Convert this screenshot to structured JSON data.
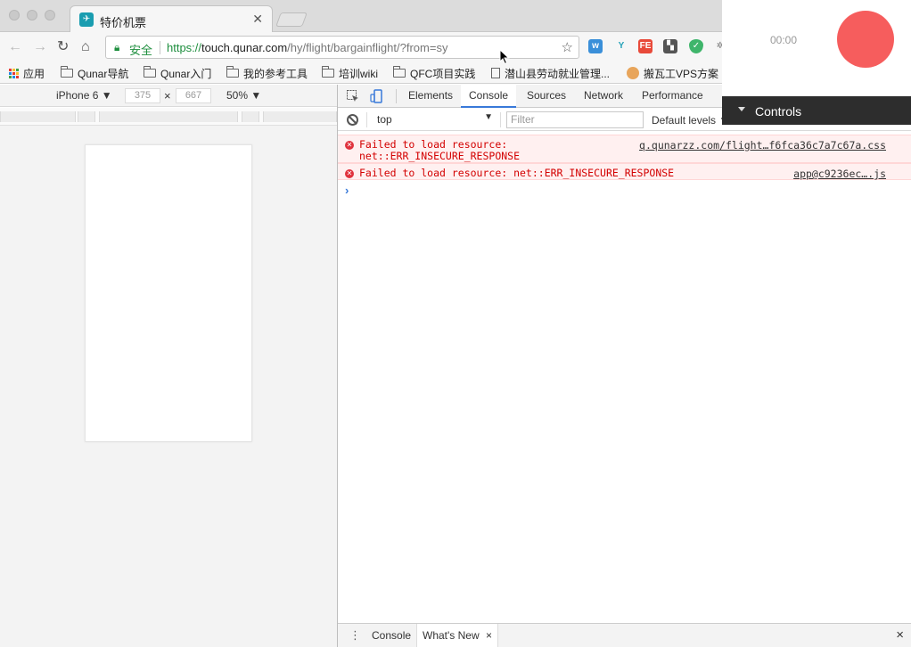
{
  "tab": {
    "title": "特价机票",
    "favicon": "qunar-icon"
  },
  "address": {
    "secure_label": "安全",
    "scheme": "https://",
    "host": "touch.qunar.com",
    "path": "/hy/flight/bargainflight/?from=sy"
  },
  "bookmarks": [
    {
      "label": "应用",
      "icon": "apps-icon"
    },
    {
      "label": "Qunar导航",
      "icon": "folder-icon"
    },
    {
      "label": "Qunar入门",
      "icon": "folder-icon"
    },
    {
      "label": "我的参考工具",
      "icon": "folder-icon"
    },
    {
      "label": "培训wiki",
      "icon": "folder-icon"
    },
    {
      "label": "QFC项目实践",
      "icon": "folder-icon"
    },
    {
      "label": "潜山县劳动就业管理...",
      "icon": "page-icon"
    },
    {
      "label": "搬瓦工VPS方案",
      "icon": "vps-icon"
    }
  ],
  "device_toolbar": {
    "device": "iPhone 6 ▼",
    "width": "375",
    "height": "667",
    "times": "×",
    "zoom": "50% ▼"
  },
  "devtools": {
    "tabs": [
      "Elements",
      "Console",
      "Sources",
      "Network",
      "Performance"
    ],
    "active_tab": "Console",
    "context": "top",
    "filter_placeholder": "Filter",
    "levels": "Default levels ▼",
    "messages": [
      {
        "line1": "Failed to load resource:",
        "line2": "net::ERR_INSECURE_RESPONSE",
        "source": "q.qunarzz.com/flight…f6fca36c7a7c67a.css"
      },
      {
        "line1": "Failed to load resource: net::ERR_INSECURE_RESPONSE",
        "line2": "",
        "source": "app@c9236ec….js"
      }
    ],
    "prompt": "›",
    "drawer": {
      "tabs": [
        "Console",
        "What's New"
      ],
      "active": "What's New",
      "close": "×"
    }
  },
  "recorder": {
    "time": "00:00",
    "controls_label": "Controls"
  },
  "colors": {
    "secure_green": "#1e8e3e",
    "error_red": "#d30000",
    "record_red": "#f65d5d",
    "active_tab_blue": "#3879d9"
  }
}
